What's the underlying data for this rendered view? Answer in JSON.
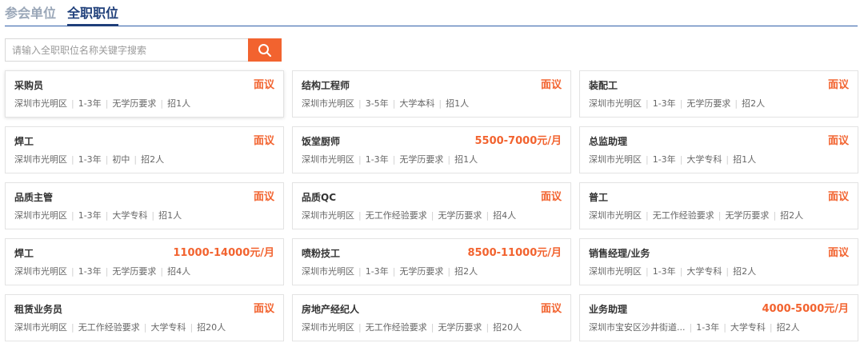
{
  "tabs": [
    {
      "label": "参会单位",
      "active": false
    },
    {
      "label": "全职职位",
      "active": true
    }
  ],
  "search": {
    "placeholder": "请输入全职职位名称关键字搜索",
    "button_icon": "search-icon"
  },
  "colors": {
    "accent": "#f2632f",
    "tab_active": "#1f3f7a",
    "tab_inactive": "#9aa7b8"
  },
  "jobs": [
    {
      "title": "采购员",
      "salary": "面议",
      "meta": [
        "深圳市光明区",
        "1-3年",
        "无学历要求",
        "招1人"
      ]
    },
    {
      "title": "结构工程师",
      "salary": "面议",
      "meta": [
        "深圳市光明区",
        "3-5年",
        "大学本科",
        "招1人"
      ]
    },
    {
      "title": "装配工",
      "salary": "面议",
      "meta": [
        "深圳市光明区",
        "1-3年",
        "无学历要求",
        "招2人"
      ]
    },
    {
      "title": "焊工",
      "salary": "面议",
      "meta": [
        "深圳市光明区",
        "1-3年",
        "初中",
        "招2人"
      ]
    },
    {
      "title": "饭堂厨师",
      "salary": "5500-7000元/月",
      "meta": [
        "深圳市光明区",
        "1-3年",
        "无学历要求",
        "招1人"
      ]
    },
    {
      "title": "总监助理",
      "salary": "面议",
      "meta": [
        "深圳市光明区",
        "1-3年",
        "大学专科",
        "招1人"
      ]
    },
    {
      "title": "品质主管",
      "salary": "面议",
      "meta": [
        "深圳市光明区",
        "1-3年",
        "大学专科",
        "招1人"
      ]
    },
    {
      "title": "品质QC",
      "salary": "面议",
      "meta": [
        "深圳市光明区",
        "无工作经验要求",
        "无学历要求",
        "招4人"
      ]
    },
    {
      "title": "普工",
      "salary": "面议",
      "meta": [
        "深圳市光明区",
        "无工作经验要求",
        "无学历要求",
        "招2人"
      ]
    },
    {
      "title": "焊工",
      "salary": "11000-14000元/月",
      "meta": [
        "深圳市光明区",
        "1-3年",
        "无学历要求",
        "招4人"
      ]
    },
    {
      "title": "喷粉技工",
      "salary": "8500-11000元/月",
      "meta": [
        "深圳市光明区",
        "1-3年",
        "无学历要求",
        "招2人"
      ]
    },
    {
      "title": "销售经理/业务",
      "salary": "面议",
      "meta": [
        "深圳市光明区",
        "1-3年",
        "大学专科",
        "招2人"
      ]
    },
    {
      "title": "租赁业务员",
      "salary": "面议",
      "meta": [
        "深圳市光明区",
        "无工作经验要求",
        "大学专科",
        "招20人"
      ]
    },
    {
      "title": "房地产经纪人",
      "salary": "面议",
      "meta": [
        "深圳市光明区",
        "无工作经验要求",
        "无学历要求",
        "招20人"
      ]
    },
    {
      "title": "业务助理",
      "salary": "4000-5000元/月",
      "meta": [
        "深圳市宝安区沙井街道...",
        "1-3年",
        "大学专科",
        "招2人"
      ]
    }
  ]
}
